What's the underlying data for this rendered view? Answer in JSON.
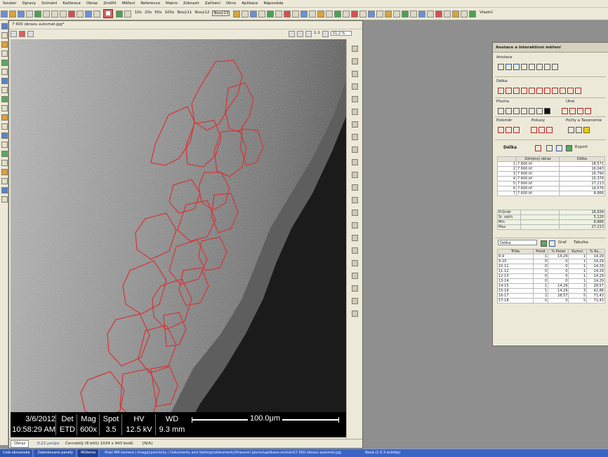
{
  "menu": [
    "Soubor",
    "Úpravy",
    "Snímání",
    "Kalibrace",
    "Obraz",
    "Změřit",
    "Měření",
    "Reference",
    "Makro",
    "Zobrazit",
    "Zařízení",
    "Okno",
    "Aplikace",
    "Nápověda"
  ],
  "toolbar": {
    "zoom_buttons": [
      "10x",
      "20x",
      "50x",
      "100x",
      "Nový11",
      "Nový12",
      "Nový13"
    ],
    "user_label": "Vlastní"
  },
  "image_window": {
    "title": "7 600 obrazu automat.jpg*",
    "one_to_one": "1:1",
    "zoom_value": "51,2 %",
    "status": {
      "tab": "Obraz",
      "pixel_size": "0,22 μm/px",
      "image_info": "Černobílý (8 bitů) 1024 x 943 bodů",
      "na": "[N/A]"
    }
  },
  "sem_info": {
    "date": "3/6/2012",
    "time": "10:58:29 AM",
    "det_label": "Det",
    "det_value": "ETD",
    "mag_label": "Mag",
    "mag_value": "600x",
    "spot_label": "Spot",
    "spot_value": "3.5",
    "hv_label": "HV",
    "hv_value": "12.5 kV",
    "wd_label": "WD",
    "wd_value": "9.3 mm",
    "scale": "100.0μm"
  },
  "panel": {
    "title": "Anotace a Interaktivní měření",
    "sections": {
      "annotations": "Anotace",
      "length": "Délka",
      "area": "Plocha",
      "angle": "Úhel",
      "radius": "Poloměr",
      "count": "Pokusy",
      "counting": "Počty a Taxonomie"
    },
    "measure_combo": "Délka",
    "export_label": "Export",
    "table_headers": [
      "",
      "Zdrojový obraz",
      "Délka"
    ],
    "rows": [
      {
        "n": "1",
        "src": "7 600.tif",
        "val": "18,571"
      },
      {
        "n": "2",
        "src": "7 600.tif",
        "val": "16,043"
      },
      {
        "n": "3",
        "src": "7 600.tif",
        "val": "16,790"
      },
      {
        "n": "4",
        "src": "7 600.tif",
        "val": "15,376"
      },
      {
        "n": "5",
        "src": "7 600.tif",
        "val": "27,213"
      },
      {
        "n": "6",
        "src": "7 600.tif",
        "val": "14,576"
      },
      {
        "n": "7",
        "src": "7 600.tif",
        "val": "8,866"
      }
    ],
    "stats": [
      {
        "label": "Průměr",
        "val": "16,934"
      },
      {
        "label": "Sr. odch.",
        "val": "5,120"
      },
      {
        "label": "Min",
        "val": "8,866"
      },
      {
        "label": "Max",
        "val": "27,213"
      }
    ],
    "hist_select": "Délka",
    "hist_graph": "Graf",
    "hist_table": "Tabulka",
    "hist_headers": [
      "Třída",
      "Počet",
      "% Počet",
      "Kumul.",
      "% Ku..."
    ],
    "hist_rows": [
      [
        "8-9",
        "1",
        "14,29",
        "1",
        "14,29"
      ],
      [
        "9-10",
        "0",
        "0",
        "1",
        "14,29"
      ],
      [
        "10-11",
        "0",
        "0",
        "1",
        "14,29"
      ],
      [
        "11-12",
        "0",
        "0",
        "1",
        "14,29"
      ],
      [
        "12-13",
        "0",
        "0",
        "1",
        "14,29"
      ],
      [
        "13-14",
        "0",
        "0",
        "1",
        "14,29"
      ],
      [
        "14-15",
        "1",
        "14,29",
        "2",
        "28,57"
      ],
      [
        "15-16",
        "1",
        "14,29",
        "3",
        "42,86"
      ],
      [
        "16-17",
        "2",
        "28,57",
        "5",
        "71,43"
      ],
      [
        "17-18",
        "0",
        "0",
        "5",
        "71,43"
      ]
    ]
  },
  "taskbar": {
    "items": [
      "Celá obrazovka",
      "Zablokované panely",
      "Můžeme"
    ],
    "path": "Pixel NM kamera | ImageJ-pomůcky | Dokumenty and Settings\\dokumenty\\Pracovní plocha\\aplikace-snímání\\7 600 obrazu automat.jpg",
    "right": "Nové (1 0 3 snímky)"
  }
}
